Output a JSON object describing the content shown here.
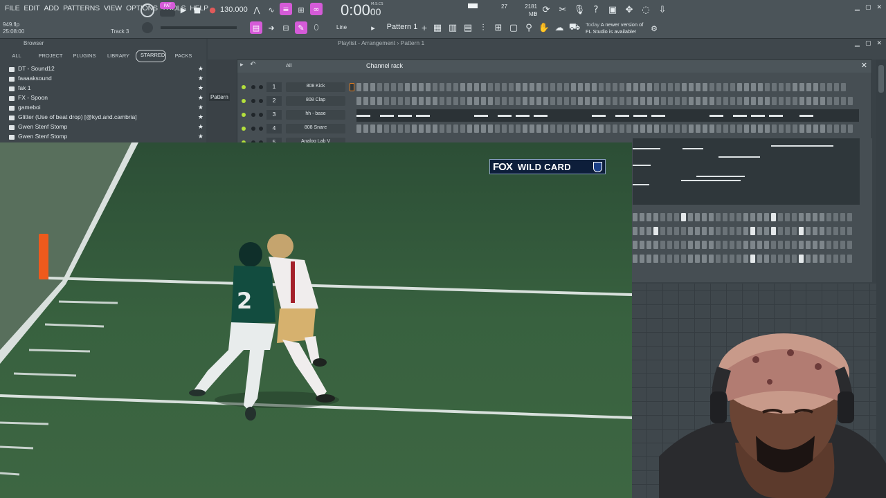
{
  "menu": [
    "FILE",
    "EDIT",
    "ADD",
    "PATTERNS",
    "VIEW",
    "OPTIONS",
    "TOOLS",
    "HELP"
  ],
  "file": {
    "name": "949.flp",
    "time": "25:08:00",
    "track": "Track 3"
  },
  "transport": {
    "tempo": "130.000",
    "time_main": "0:00",
    "time_small": "00",
    "time_unit": "M:S:CS",
    "pat_label": "PAT"
  },
  "status": {
    "cpu": "27",
    "mem": "2181 MB",
    "mem_sub": "0"
  },
  "toolbar": {
    "pattern": "Pattern 1",
    "snap": "Line"
  },
  "news": {
    "when": "Today",
    "line1": "A newer version of",
    "line2": "FL Studio is available!"
  },
  "browser": {
    "title": "Browser",
    "tabs": [
      "ALL",
      "PROJECT",
      "PLUGINS",
      "LIBRARY",
      "STARRED",
      "PACKS"
    ],
    "active_tab": "STARRED",
    "items": [
      "DT - Sound12",
      "faaaaksound",
      "fak 1",
      "FX - Spoon",
      "gameboi",
      "Glitter (Use of beat drop) [@kyd.and.cambria]",
      "Gwen Stenf Stomp",
      "Gwen Stenf Stomp"
    ]
  },
  "playlist": {
    "title": "Playlist - Arrangement",
    "pattern": "Pattern 1",
    "tag": "Pattern"
  },
  "rack": {
    "title": "Channel rack",
    "filter": "All",
    "channels": [
      {
        "num": "1",
        "name": "808 Kick"
      },
      {
        "num": "2",
        "name": "808 Clap"
      },
      {
        "num": "3",
        "name": "hh - base"
      },
      {
        "num": "4",
        "name": "808 Snare"
      },
      {
        "num": "5",
        "name": "Analog Lab V"
      }
    ]
  },
  "video": {
    "network": "FOX",
    "event": "WILD CARD",
    "jersey_number": "2"
  },
  "colors": {
    "accent": "#d55bd8",
    "led": "#b4e03c",
    "field": "#30513a"
  }
}
